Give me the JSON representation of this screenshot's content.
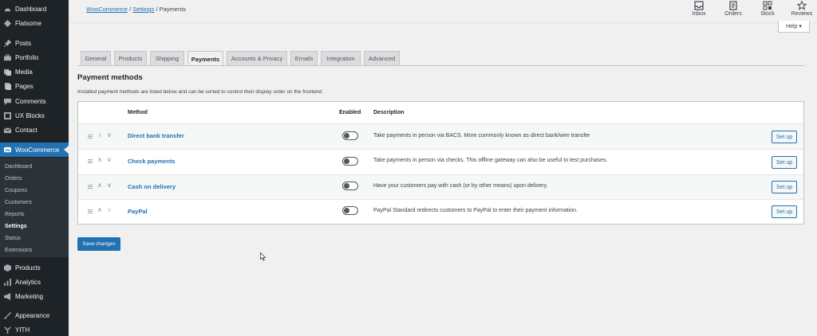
{
  "sidebar": {
    "items": [
      {
        "label": "Dashboard",
        "icon": "dashboard-icon"
      },
      {
        "label": "Flatsome",
        "icon": "flatsome-icon"
      },
      {
        "label": "Posts",
        "icon": "pin-icon"
      },
      {
        "label": "Portfolio",
        "icon": "portfolio-icon"
      },
      {
        "label": "Media",
        "icon": "media-icon"
      },
      {
        "label": "Pages",
        "icon": "pages-icon"
      },
      {
        "label": "Comments",
        "icon": "comments-icon"
      },
      {
        "label": "UX Blocks",
        "icon": "blocks-icon"
      },
      {
        "label": "Contact",
        "icon": "mail-icon"
      },
      {
        "label": "WooCommerce",
        "icon": "woocommerce-icon"
      },
      {
        "label": "Products",
        "icon": "products-icon"
      },
      {
        "label": "Analytics",
        "icon": "analytics-icon"
      },
      {
        "label": "Marketing",
        "icon": "megaphone-icon"
      },
      {
        "label": "Appearance",
        "icon": "brush-icon"
      },
      {
        "label": "YITH",
        "icon": "yith-icon"
      }
    ],
    "submenu": [
      "Dashboard",
      "Orders",
      "Coupons",
      "Customers",
      "Reports",
      "Settings",
      "Status",
      "Extensions"
    ]
  },
  "breadcrumb": {
    "woocommerce": "WooCommerce",
    "settings": "Settings",
    "current": "Payments",
    "sep": "/"
  },
  "header": {
    "inbox": "Inbox",
    "orders": "Orders",
    "stock": "Stock",
    "reviews": "Reviews",
    "help": "Help ▾"
  },
  "tabs": [
    "General",
    "Products",
    "Shipping",
    "Payments",
    "Accounts & Privacy",
    "Emails",
    "Integration",
    "Advanced"
  ],
  "section": {
    "title": "Payment methods",
    "description": "Installed payment methods are listed below and can be sorted to control their display order on the frontend."
  },
  "table": {
    "headers": {
      "method": "Method",
      "enabled": "Enabled",
      "description": "Description"
    },
    "rows": [
      {
        "name": "Direct bank transfer",
        "enabled": false,
        "description": "Take payments in person via BACS. More commonly known as direct bank/wire transfer",
        "action": "Set up"
      },
      {
        "name": "Check payments",
        "enabled": false,
        "description": "Take payments in person via checks. This offline gateway can also be useful to test purchases.",
        "action": "Set up"
      },
      {
        "name": "Cash on delivery",
        "enabled": false,
        "description": "Have your customers pay with cash (or by other means) upon delivery.",
        "action": "Set up"
      },
      {
        "name": "PayPal",
        "enabled": false,
        "description": "PayPal Standard redirects customers to PayPal to enter their payment information.",
        "action": "Set up"
      }
    ]
  },
  "save_label": "Save changes",
  "colors": {
    "accent": "#2271b1",
    "sidebar": "#1d2327",
    "background": "#f0f0f1"
  }
}
